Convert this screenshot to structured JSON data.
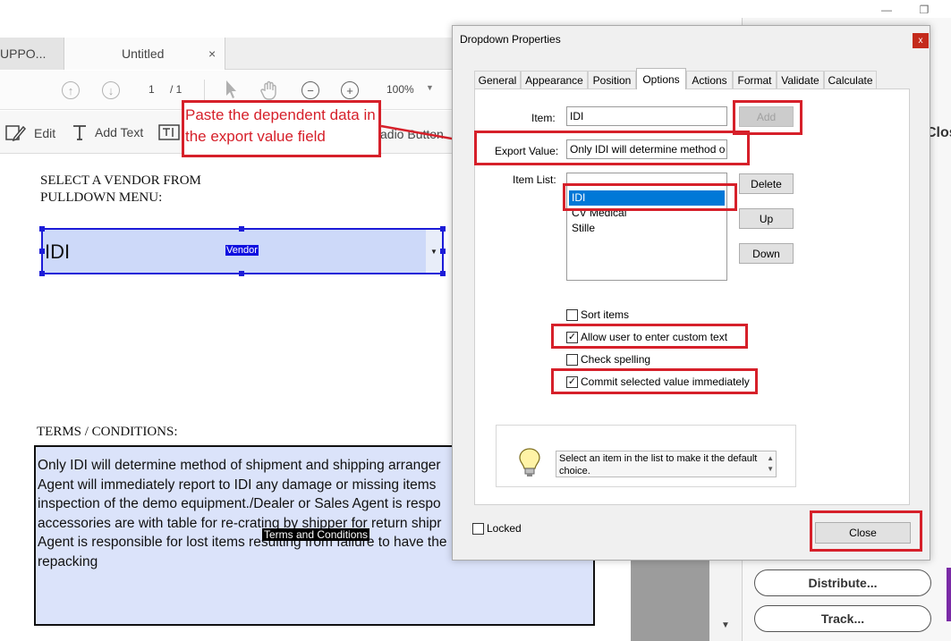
{
  "app": {
    "tabs": [
      {
        "label": "UPPO..."
      },
      {
        "label": "Untitled"
      }
    ],
    "tab_close": "×",
    "window_controls": {
      "minimize": "—",
      "restore": "❐"
    }
  },
  "toolbar": {
    "page_current": "1",
    "page_total": "/ 1",
    "zoom": "100%",
    "icons": [
      "page-up-icon",
      "page-down-icon",
      "select-arrow-icon",
      "hand-icon",
      "zoom-out-icon",
      "zoom-in-icon"
    ]
  },
  "edit_toolbar": {
    "edit_label": "Edit",
    "add_text_label": "Add Text",
    "radio_button_label": "adio Button"
  },
  "document": {
    "vendor_heading": "SELECT A VENDOR FROM PULLDOWN MENU:",
    "vendor_field_value": "IDI",
    "vendor_field_name": "Vendor",
    "terms_heading": "TERMS / CONDITIONS:",
    "terms_text": "Only IDI will determine method of shipment and shipping arranger\nAgent will immediately report to IDI any damage or missing items\ninspection of the demo equipment./Dealer or Sales Agent is respo\naccessories are with table for re-crating by shipper for return shipr\nAgent is responsible for lost items resulting from failure to have the\nrepacking",
    "terms_field_name": "Terms and Conditions"
  },
  "annotation": {
    "callout_text": "Paste the dependent data in the export value field",
    "color": "#d6202a"
  },
  "dialog": {
    "title": "Dropdown Properties",
    "close_glyph": "x",
    "tabs": [
      "General",
      "Appearance",
      "Position",
      "Options",
      "Actions",
      "Format",
      "Validate",
      "Calculate"
    ],
    "active_tab": "Options",
    "item_label": "Item:",
    "item_value": "IDI",
    "add_button": "Add",
    "export_value_label": "Export Value:",
    "export_value": "Only IDI will determine method o",
    "item_list_label": "Item List:",
    "item_list": [
      "IDI",
      "CV Medical",
      "Stille"
    ],
    "selected_item": "IDI",
    "delete_button": "Delete",
    "up_button": "Up",
    "down_button": "Down",
    "checkboxes": [
      {
        "label": "Sort items",
        "checked": false
      },
      {
        "label": "Allow user to enter custom text",
        "checked": true
      },
      {
        "label": "Check spelling",
        "checked": false
      },
      {
        "label": "Commit selected value immediately",
        "checked": true
      }
    ],
    "check_glyph": "✓",
    "tip_text": "Select an item in the list to make it the default choice.",
    "locked_label": "Locked",
    "close_button": "Close"
  },
  "right_panel": {
    "close_label": "Clos",
    "distribute_button": "Distribute...",
    "track_button": "Track...",
    "scroll_down_glyph": "▼"
  },
  "colors": {
    "accent": "#0078d7",
    "annotation_red": "#d6202a",
    "field_fill": "#cdd9f9",
    "field_border": "#1c1cd8"
  }
}
